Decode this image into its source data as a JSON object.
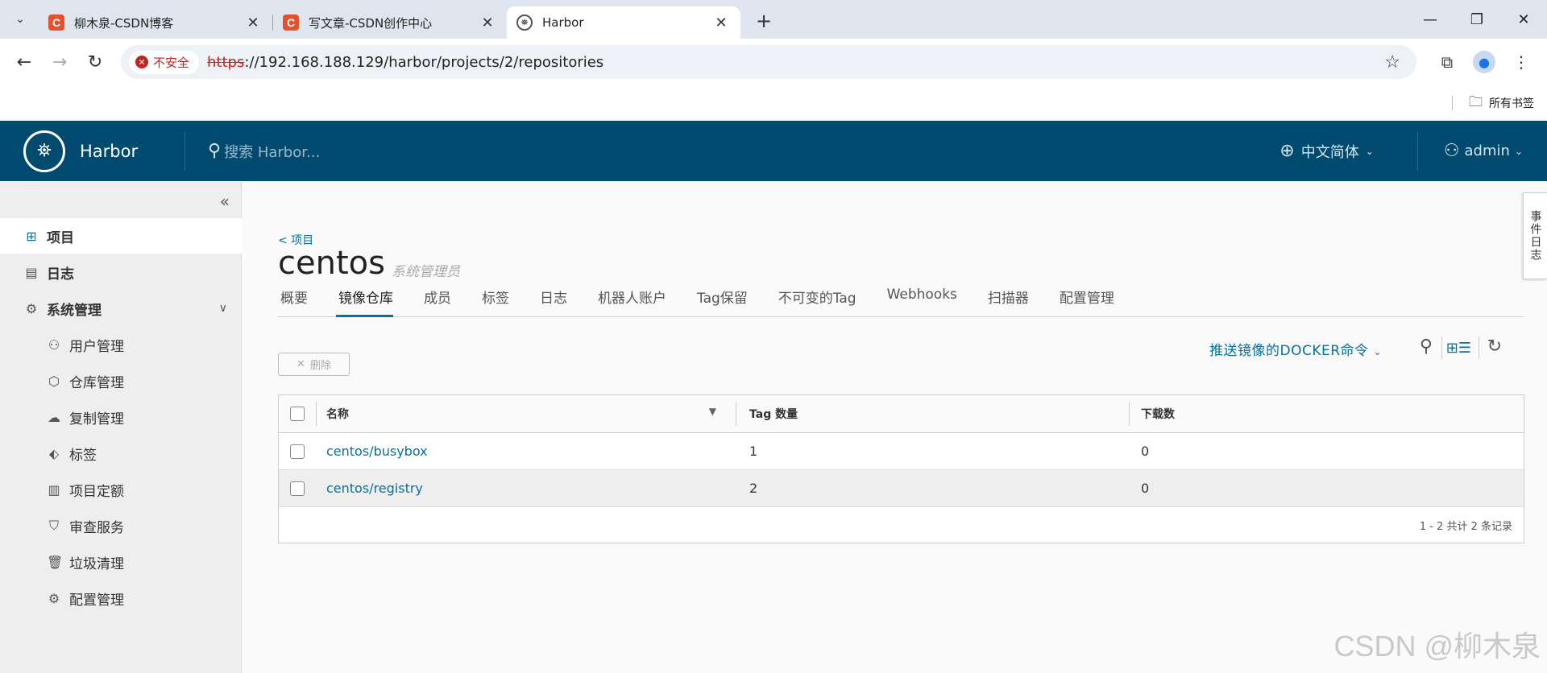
{
  "browser": {
    "tabs": [
      {
        "title": "柳木泉-CSDN博客",
        "favicon": "C"
      },
      {
        "title": "写文章-CSDN创作中心",
        "favicon": "C"
      },
      {
        "title": "Harbor",
        "favicon": "harbor"
      }
    ],
    "security_label": "不安全",
    "url_scheme": "https",
    "url_rest": "://192.168.188.129/harbor/projects/2/repositories",
    "bookmarks_label": "所有书签"
  },
  "header": {
    "brand": "Harbor",
    "search_placeholder": "搜索 Harbor...",
    "language": "中文简体",
    "user": "admin"
  },
  "sidebar": {
    "items": [
      {
        "label": "项目",
        "icon": "projects-icon"
      },
      {
        "label": "日志",
        "icon": "logs-icon"
      },
      {
        "label": "系统管理",
        "icon": "admin-icon"
      },
      {
        "label": "用户管理",
        "icon": "users-icon"
      },
      {
        "label": "仓库管理",
        "icon": "registry-icon"
      },
      {
        "label": "复制管理",
        "icon": "replication-icon"
      },
      {
        "label": "标签",
        "icon": "tag-icon"
      },
      {
        "label": "项目定额",
        "icon": "quota-icon"
      },
      {
        "label": "审查服务",
        "icon": "shield-icon"
      },
      {
        "label": "垃圾清理",
        "icon": "trash-icon"
      },
      {
        "label": "配置管理",
        "icon": "gear-icon"
      }
    ]
  },
  "project": {
    "breadcrumb": "< 项目",
    "name": "centos",
    "role": "系统管理员",
    "tabs": [
      "概要",
      "镜像仓库",
      "成员",
      "标签",
      "日志",
      "机器人账户",
      "Tag保留",
      "不可变的Tag",
      "Webhooks",
      "扫描器",
      "配置管理"
    ],
    "active_tab": 1
  },
  "repos": {
    "delete_label": "删除",
    "push_command": "推送镜像的DOCKER命令",
    "columns": [
      "名称",
      "Tag 数量",
      "下载数"
    ],
    "rows": [
      {
        "name": "centos/busybox",
        "tags": "1",
        "pulls": "0"
      },
      {
        "name": "centos/registry",
        "tags": "2",
        "pulls": "0"
      }
    ],
    "pagination": "1 - 2 共计 2 条记录"
  },
  "event_log": "事件日志",
  "watermark": "CSDN @柳木泉"
}
